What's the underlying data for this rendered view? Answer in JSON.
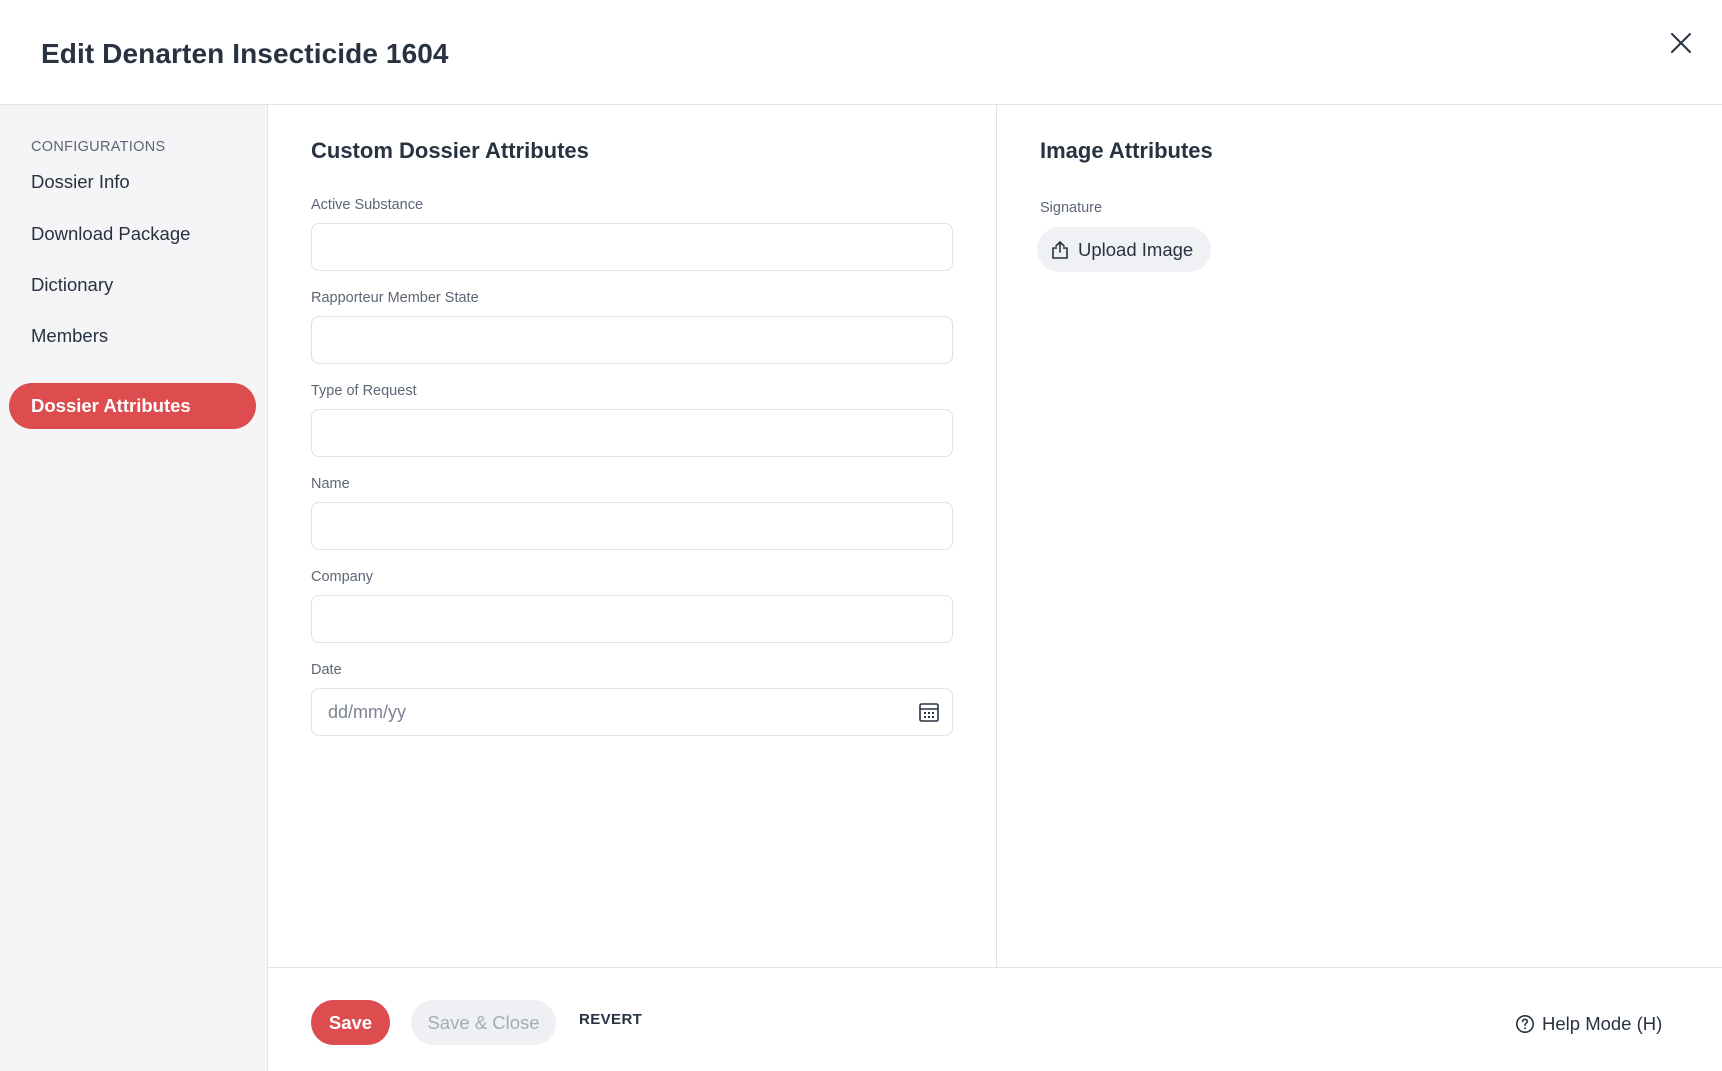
{
  "header": {
    "title": "Edit Denarten Insecticide 1604"
  },
  "sidebar": {
    "heading": "CONFIGURATIONS",
    "items": [
      {
        "label": "Dossier Info",
        "active": false
      },
      {
        "label": "Download Package",
        "active": false
      },
      {
        "label": "Dictionary",
        "active": false
      },
      {
        "label": "Members",
        "active": false
      },
      {
        "label": "Dossier Attributes",
        "active": true
      }
    ]
  },
  "custom_attributes": {
    "title": "Custom Dossier Attributes",
    "fields": [
      {
        "label": "Active Substance",
        "value": "",
        "placeholder": ""
      },
      {
        "label": "Rapporteur Member State",
        "value": "",
        "placeholder": ""
      },
      {
        "label": "Type of Request",
        "value": "",
        "placeholder": ""
      },
      {
        "label": "Name",
        "value": "",
        "placeholder": ""
      },
      {
        "label": "Company",
        "value": "",
        "placeholder": ""
      },
      {
        "label": "Date",
        "value": "",
        "placeholder": "dd/mm/yy"
      }
    ]
  },
  "image_attributes": {
    "title": "Image Attributes",
    "signature_label": "Signature",
    "upload_label": "Upload Image"
  },
  "footer": {
    "save_label": "Save",
    "save_close_label": "Save & Close",
    "revert_label": "REVERT",
    "help_label": "Help Mode (H)"
  },
  "colors": {
    "accent": "#dd4d50",
    "text": "#283241",
    "muted": "#5c6675",
    "sidebar_bg": "#f5f5f7",
    "border": "#e2e4e9"
  },
  "icons": {
    "close": "close-icon",
    "calendar": "calendar-icon",
    "upload": "upload-icon",
    "help": "help-circle-icon"
  }
}
